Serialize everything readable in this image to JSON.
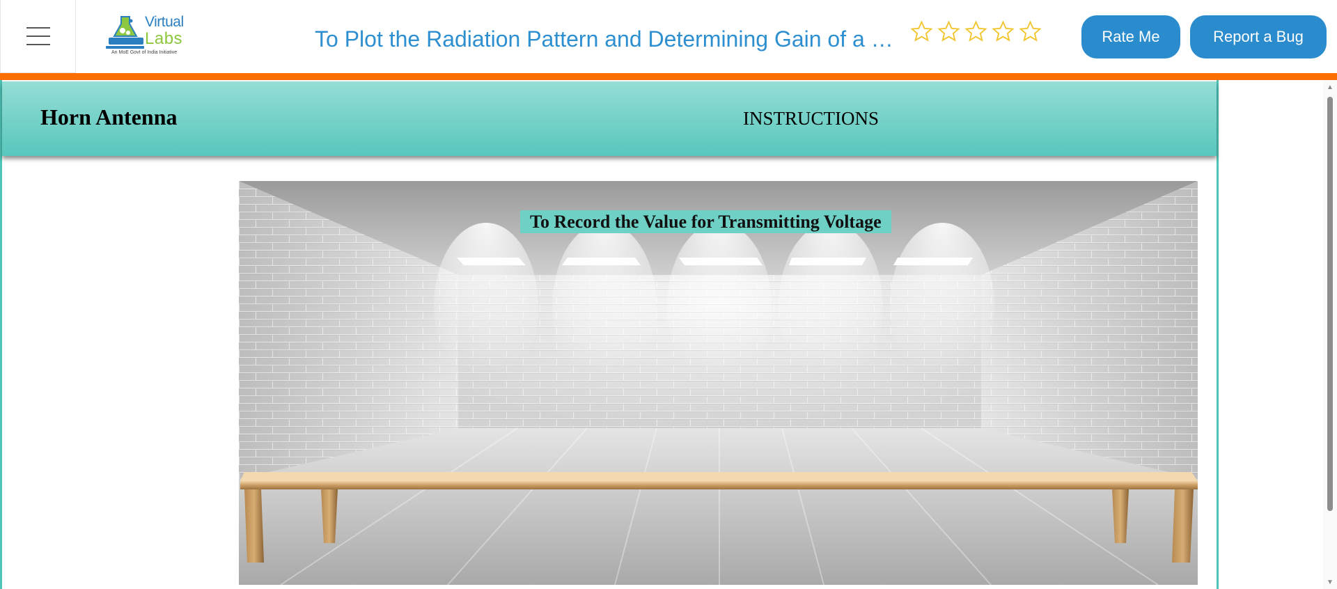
{
  "header": {
    "menu_icon": "hamburger-menu-icon",
    "logo": {
      "line1": "Virtual",
      "line2": "Labs",
      "tagline": "An MoE Govt of India Initiative"
    },
    "experiment_title": "To Plot the Radiation Pattern and Determining Gain of a Horn Antenna",
    "rating": {
      "total_stars": 5,
      "filled": 0,
      "star_color": "#f2c531"
    },
    "rate_button": "Rate Me",
    "bug_button": "Report a Bug",
    "accent_color": "#ff6f00",
    "button_color": "#2a8bcd"
  },
  "simulation": {
    "title": "Horn Antenna",
    "instructions_label": "INSTRUCTIONS",
    "header_color": "#58c7bd",
    "scene_caption": "To Record the Value for Transmitting Voltage",
    "scene_elements": [
      "brick-room-background",
      "ceiling-light-icon",
      "wooden-table"
    ]
  }
}
